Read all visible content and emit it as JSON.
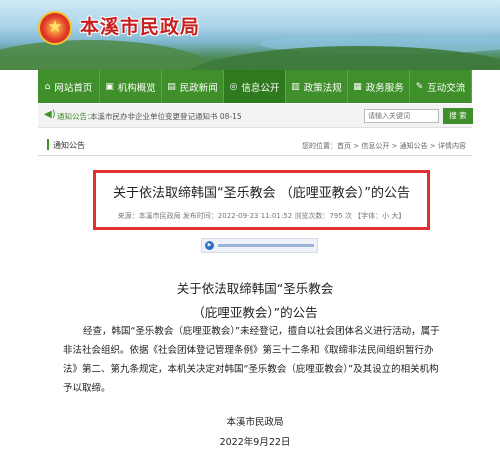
{
  "header": {
    "site_title": "本溪市民政局",
    "emblem_icon": "national-emblem-icon"
  },
  "nav": {
    "items": [
      {
        "label": "网站首页",
        "icon": "home-icon",
        "glyph": "⌂",
        "active": false
      },
      {
        "label": "机构概览",
        "icon": "org-icon",
        "glyph": "▣",
        "active": false
      },
      {
        "label": "民政新闻",
        "icon": "news-icon",
        "glyph": "▤",
        "active": false
      },
      {
        "label": "信息公开",
        "icon": "info-icon",
        "glyph": "◎",
        "active": true
      },
      {
        "label": "政策法规",
        "icon": "policy-icon",
        "glyph": "▥",
        "active": false
      },
      {
        "label": "政务服务",
        "icon": "service-icon",
        "glyph": "▦",
        "active": false
      },
      {
        "label": "互动交流",
        "icon": "chat-icon",
        "glyph": "✎",
        "active": false
      }
    ]
  },
  "notice": {
    "label": "通知公告：",
    "text": "本溪市民办非企业单位变更登记通知书 08-15",
    "search_placeholder": "请输入关键词",
    "search_button": "搜 索"
  },
  "section": {
    "title": "通知公告",
    "breadcrumb": "您的位置：首页 > 信息公开 > 通知公告 > 详情内容"
  },
  "article": {
    "title": "关于依法取缔韩国“圣乐教会 （庇哩亚教会）”的公告",
    "meta": "来源：本溪市民政局    发布时间：2022-09-23 11:01:52    浏览次数：795  次    【字体：小 大】",
    "heading_line1": "关于依法取缔韩国“圣乐教会",
    "heading_line2": "（庇哩亚教会）”的公告",
    "body": "经查，韩国“圣乐教会（庇哩亚教会）”未经登记，擅自以社会团体名义进行活动，属于非法社会组织。依据《社会团体登记管理条例》第三十二条和《取缔非法民间组织暂行办法》第二、第九条规定，本机关决定对韩国“圣乐教会（庇哩亚教会）”及其设立的相关机构予以取缔。",
    "signature_org": "本溪市民政局",
    "signature_date": "2022年9月22日"
  },
  "colors": {
    "brand_green": "#3f8f2a",
    "highlight_red": "#e03030",
    "title_red": "#c81e1e"
  }
}
